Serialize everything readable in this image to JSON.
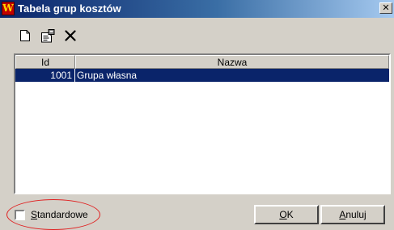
{
  "window": {
    "title": "Tabela grup kosztów",
    "close_glyph": "✕",
    "app_icon_letter": "W"
  },
  "toolbar": {
    "buttons": [
      {
        "icon": "new-document-icon"
      },
      {
        "icon": "properties-icon"
      },
      {
        "icon": "delete-icon"
      }
    ]
  },
  "table": {
    "columns": [
      "Id",
      "Nazwa"
    ],
    "rows": [
      {
        "id": "1001",
        "name": "Grupa własna",
        "selected": true
      }
    ]
  },
  "options": {
    "standard": {
      "mnemonic": "S",
      "rest": "tandardowe",
      "checked": false
    }
  },
  "buttons": {
    "ok": {
      "mnemonic": "O",
      "rest": "K"
    },
    "cancel": {
      "mnemonic": "A",
      "rest": "nuluj"
    }
  },
  "colors": {
    "selection": "#0a246a",
    "highlight_annotation": "#e02020"
  }
}
